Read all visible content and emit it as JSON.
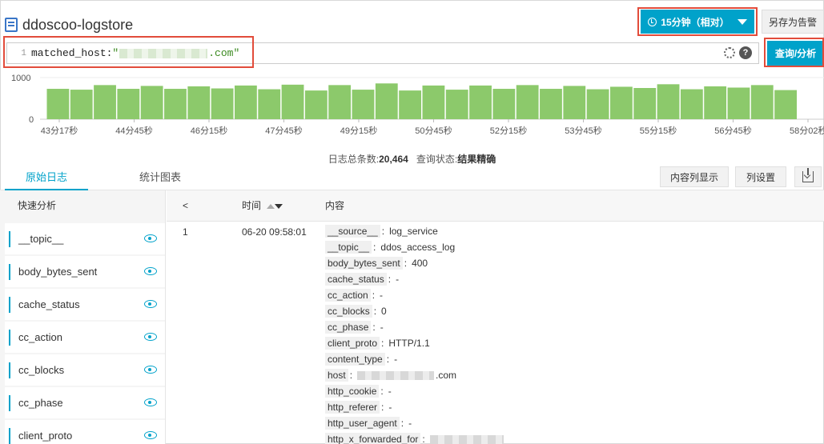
{
  "header": {
    "title": "ddoscoo-logstore",
    "time_range": "15分钟（相对）",
    "save_alert": "另存为告警"
  },
  "query": {
    "line_number": "1",
    "prefix": "matched_host:",
    "string_open": "\"",
    "string_suffix": ".com\"",
    "search_button": "查询/分析",
    "help_glyph": "?"
  },
  "histogram": {
    "y_max_label": "1000",
    "y_min_label": "0",
    "y_max": 1000,
    "x_labels": [
      "43分17秒",
      "44分45秒",
      "46分15秒",
      "47分45秒",
      "49分15秒",
      "50分45秒",
      "52分15秒",
      "53分45秒",
      "55分15秒",
      "56分45秒",
      "58分02秒"
    ],
    "bar_color": "#8cc96b",
    "values": [
      730,
      710,
      820,
      730,
      800,
      730,
      790,
      740,
      810,
      720,
      830,
      690,
      820,
      710,
      860,
      690,
      810,
      710,
      810,
      730,
      820,
      730,
      800,
      720,
      780,
      750,
      840,
      720,
      790,
      760,
      820,
      700
    ]
  },
  "summary": {
    "count_label": "日志总条数:",
    "count_value": "20,464",
    "status_label": "查询状态:",
    "status_value": "结果精确"
  },
  "tabs": {
    "raw_logs": "原始日志",
    "charts": "统计图表",
    "column_display": "内容列显示",
    "column_settings": "列设置"
  },
  "sidebar": {
    "title": "快速分析",
    "fields": [
      "__topic__",
      "body_bytes_sent",
      "cache_status",
      "cc_action",
      "cc_blocks",
      "cc_phase",
      "client_proto"
    ]
  },
  "log_table": {
    "col_time": "时间",
    "col_content": "内容",
    "collapse_glyph": "<",
    "row": {
      "index": "1",
      "time": "06-20 09:58:01",
      "fields": [
        {
          "key": "__source__",
          "value": "log_service"
        },
        {
          "key": "__topic__",
          "value": "ddos_access_log"
        },
        {
          "key": "body_bytes_sent",
          "value": "400"
        },
        {
          "key": "cache_status",
          "value": "-"
        },
        {
          "key": "cc_action",
          "value": "-"
        },
        {
          "key": "cc_blocks",
          "value": "0"
        },
        {
          "key": "cc_phase",
          "value": "-"
        },
        {
          "key": "client_proto",
          "value": "HTTP/1.1"
        },
        {
          "key": "content_type",
          "value": "-"
        },
        {
          "key": "host",
          "value": ".com"
        },
        {
          "key": "http_cookie",
          "value": "-"
        },
        {
          "key": "http_referer",
          "value": "-"
        },
        {
          "key": "http_user_agent",
          "value": "-"
        },
        {
          "key": "http_x_forwarded_for",
          "value": ""
        }
      ]
    }
  }
}
